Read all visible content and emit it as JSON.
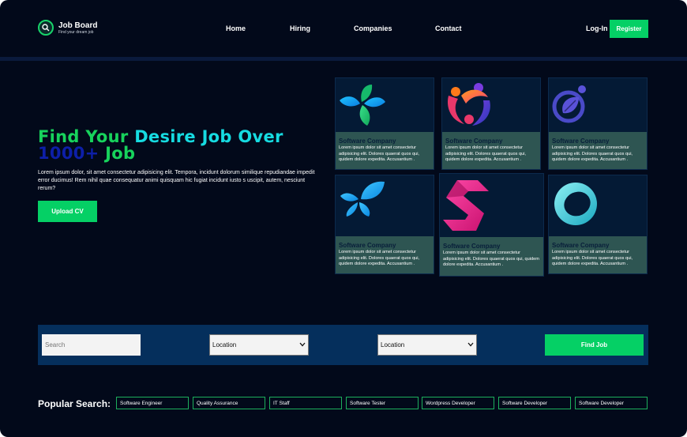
{
  "header": {
    "brand": "Job Board",
    "tagline": "Find your dream job",
    "nav": [
      "Home",
      "Hiring",
      "Companies",
      "Contact"
    ],
    "login_label": "Log-In",
    "register_label": "Register"
  },
  "hero": {
    "title_part1": "Find Your",
    "title_part2": "Desire Job Over",
    "title_part3": "1000+",
    "title_part4": "Job",
    "description": "Lorem ipsum dolor, sit amet consectetur adipisicing elit. Tempora, incidunt dolorum similique repudiandae impedit error ducimus! Rem nihil quae consequatur animi quisquam hic fugiat incidunt iusto s uscipit, autem, nesciunt rerum?",
    "upload_label": "Upload CV"
  },
  "companies": [
    {
      "name": "Software Company",
      "text": "Lorem ipsum dolor sit amet consectetur adipisicing elit. Dolores quaerat quos qui, quidem dolore expedita. Accusantium .",
      "logo": "four-petal-logo"
    },
    {
      "name": "Software Company",
      "text": "Lorem ipsum dolor sit amet consectetur adipisicing elit. Dolores quaerat quos qui, quidem dolore expedita. Accusantium .",
      "logo": "people-circle-logo"
    },
    {
      "name": "Software Company",
      "text": "Lorem ipsum dolor sit amet consectetur adipisicing elit. Dolores quaerat quos qui, quidem dolore expedita. Accusantium .",
      "logo": "leaf-circle-logo"
    },
    {
      "name": "Software Company",
      "text": "Lorem ipsum dolor sit amet consectetur adipisicing elit. Dolores quaerat quos qui, quidem dolore expedita. Accusantium .",
      "logo": "butterfly-logo"
    },
    {
      "name": "Software Company",
      "text": "Lorem ipsum dolor sit amet consectetur adipisicing elit. Dolores quaerat quos qui, quidem dolore expedita. Accusantium .",
      "logo": "s-hexagon-logo"
    },
    {
      "name": "Software Company",
      "text": "Lorem ipsum dolor sit amet consectetur adipisicing elit. Dolores quaerat quos qui, quidem dolore expedita. Accusantium .",
      "logo": "ring-logo"
    }
  ],
  "search": {
    "placeholder": "Search",
    "location1": "Location",
    "location2": "Location",
    "find_label": "Find Job"
  },
  "popular": {
    "label": "Popular Search:",
    "tags": [
      "Software Engineer",
      "Quality Assurance",
      "IT Staff",
      "Software Tester",
      "Wordpress Developer",
      "Software Developer",
      "Software Developer"
    ]
  },
  "colors": {
    "background": "#02091a",
    "accent_green": "#05d065",
    "cyan": "#16dbe1",
    "dark_blue": "#0d1fa8",
    "card_body": "#2e5552",
    "search_bar": "#052f5c"
  }
}
